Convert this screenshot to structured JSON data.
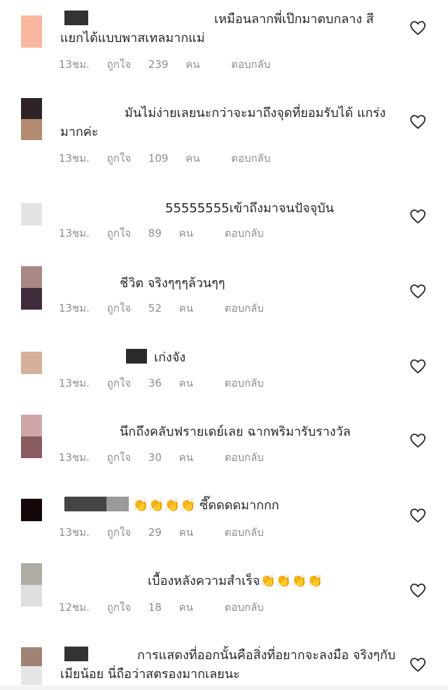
{
  "colors": {
    "meta_text": "#8e8e8e",
    "body_text": "#262626",
    "heart_stroke": "#262626"
  },
  "like_prefix": "ถูกใจ",
  "like_suffix": "คน",
  "reply_label": "ตอบกลับ",
  "comments": [
    {
      "text": "เหมือนลากพี่เป๊กมาตบกลาง สีแยกได้แบบพาสเทลมากแม่",
      "time": "13ชม.",
      "likes": "239"
    },
    {
      "text": "มันไม่ง่ายเลยนะกว่าจะมาถึงจุดที่ยอมรับได้ แกร่งมากค่ะ",
      "time": "13ชม.",
      "likes": "109"
    },
    {
      "text": "55555555เข้าถึงมาจนปัจจุบัน",
      "time": "13ชม.",
      "likes": "89"
    },
    {
      "text": "ชีวิต จริงๆๆๆล้วนๆๆ",
      "time": "13ชม.",
      "likes": "52"
    },
    {
      "text": "เก่งจัง",
      "time": "13ชม.",
      "likes": "36"
    },
    {
      "text": "นึกถึงคลับฟรายเดย์เลย ฉากพริมารับรางวัล",
      "time": "13ชม.",
      "likes": "30"
    },
    {
      "text": "ซี๊ดดดดมากกก",
      "time": "13ชม.",
      "likes": "29",
      "emoji": "👏👏👏👏"
    },
    {
      "text": "เบื้องหลังความสำเร็จ",
      "time": "12ชม.",
      "likes": "18",
      "emoji": "👏👏👏👏"
    },
    {
      "text": "การแสดงที่ออกนั้นคือสิ่งที่อยากจะลงมือ จริงๆกับเมียน้อย นี่ถือว่าสตรองมากเลยนะ"
    }
  ]
}
